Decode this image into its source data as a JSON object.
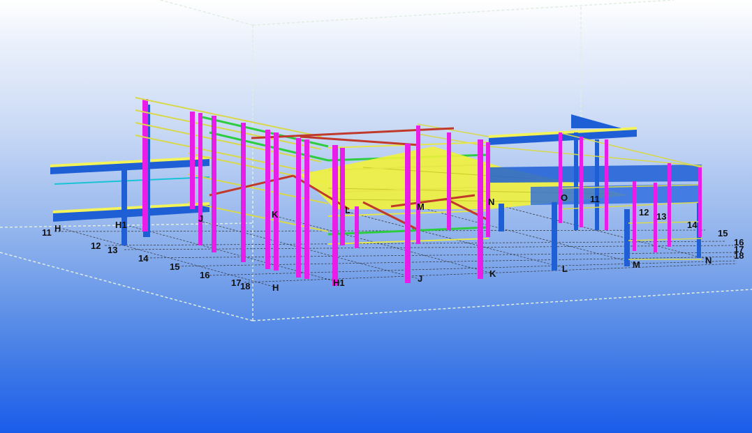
{
  "viewport": {
    "name": "3D model view",
    "background_top": "#ffffff",
    "background_bottom": "#1a5cea"
  },
  "colors": {
    "column": "#e81ee8",
    "beam": "#1f5fd6",
    "rail": "#e6e64a",
    "brace": "#c0392b",
    "deck": "#f2f23c",
    "green_member": "#2ecc40",
    "cyan_member": "#19c3d6",
    "grid_line": "#3a3a3a",
    "work_area_line": "#e8f3e8"
  },
  "grid_labels_left": {
    "h_top": "H",
    "h1_top": "H1",
    "j_top": "J",
    "k_top": "K",
    "l_top": "L",
    "m_top": "M",
    "n_top": "N",
    "o_top": "O",
    "row11_top": "11",
    "row12_top": "12",
    "row13_top": "13",
    "row14_top": "14"
  },
  "grid_labels_rows_left": [
    "11",
    "12",
    "13",
    "14",
    "15",
    "16",
    "17",
    "18"
  ],
  "grid_labels_bottom": [
    "H",
    "H1",
    "J",
    "K",
    "L",
    "M",
    "N"
  ],
  "grid_labels_rows_right": [
    "15",
    "16",
    "17",
    "18"
  ]
}
